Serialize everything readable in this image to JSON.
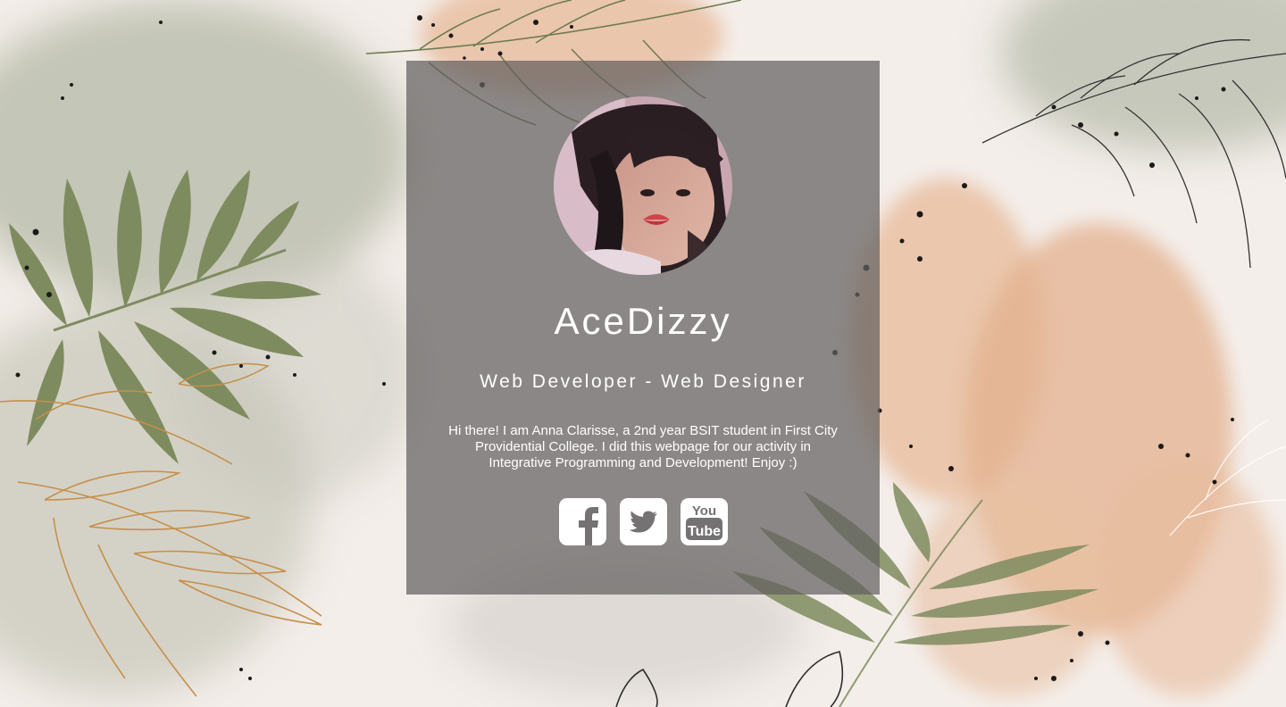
{
  "profile": {
    "name": "AceDizzy",
    "role": "Web Developer - Web Designer",
    "bio": "Hi there! I am Anna Clarisse, a 2nd year BSIT student in First City Providential College. I did this webpage for our activity in Integrative Programming and Development! Enjoy :)"
  },
  "socials": [
    {
      "name": "facebook",
      "icon": "facebook-icon"
    },
    {
      "name": "twitter",
      "icon": "twitter-icon"
    },
    {
      "name": "youtube",
      "icon": "youtube-icon",
      "text_top": "You",
      "text_bottom": "Tube"
    }
  ],
  "colors": {
    "card_bg": "#626060",
    "text": "#ffffff",
    "leaf_green": "#7d8a5e",
    "leaf_gold": "#c4914f",
    "wash_peach": "#e6b898",
    "wash_sage": "#b9bcac"
  }
}
